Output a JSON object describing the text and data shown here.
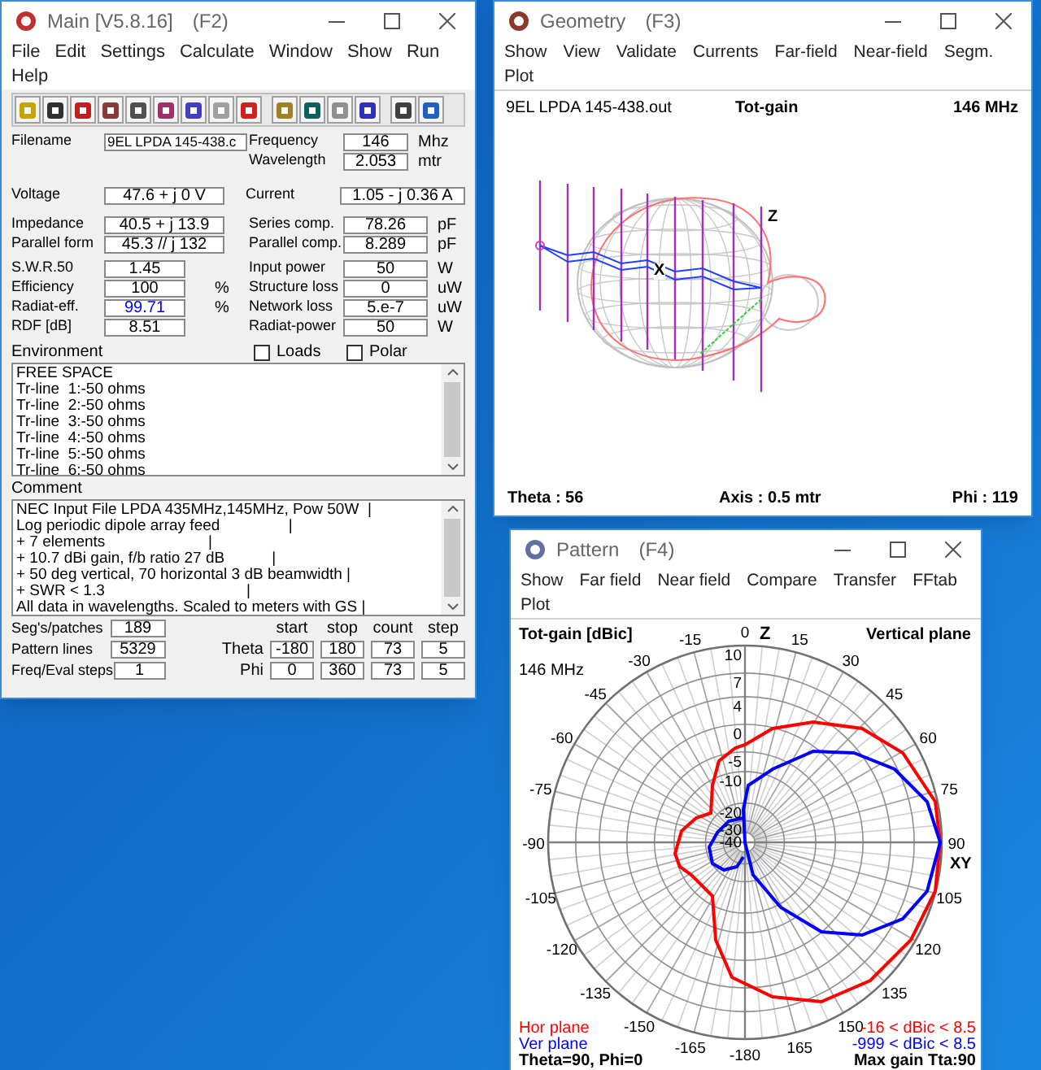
{
  "main": {
    "title": "Main [V5.8.16]",
    "hotkey": "(F2)",
    "menu": [
      "File",
      "Edit",
      "Settings",
      "Calculate",
      "Window",
      "Show",
      "Run",
      "Help"
    ],
    "field_groups": [
      [
        {
          "left": {
            "label": "Filename",
            "value": "9EL LPDA 145-438.c",
            "highlighted": false
          },
          "right": {
            "label": "Frequency",
            "value": "146",
            "unit": "Mhz",
            "highlighted": false
          }
        },
        {
          "right": {
            "label": "Wavelength",
            "value": "2.053",
            "unit": "mtr",
            "highlighted": false
          }
        }
      ],
      [
        {
          "left": {
            "label": "Voltage",
            "value": "47.6 + j 0 V",
            "highlighted": false
          },
          "right": {
            "label": "Current",
            "value": "1.05 - j 0.36 A",
            "highlighted": false
          }
        }
      ],
      [
        {
          "left": {
            "label": "Impedance",
            "value": "40.5 + j 13.9",
            "highlighted": false
          },
          "right": {
            "label": "Series comp.",
            "value": "78.26",
            "unit": "pF",
            "highlighted": false
          }
        },
        {
          "left": {
            "label": "Parallel form",
            "value": "45.3 // j 132",
            "highlighted": false
          },
          "right": {
            "label": "Parallel comp.",
            "value": "8.289",
            "unit": "pF",
            "highlighted": false
          }
        }
      ],
      [
        {
          "left": {
            "label": "S.W.R.50",
            "value": "1.45",
            "highlighted": false
          },
          "right": {
            "label": "Input power",
            "value": "50",
            "unit": "W",
            "highlighted": false
          }
        },
        {
          "left": {
            "label": "Efficiency",
            "value": "100",
            "unit": "%",
            "highlighted": false
          },
          "right": {
            "label": "Structure loss",
            "value": "0",
            "unit": "uW",
            "highlighted": false
          }
        },
        {
          "left": {
            "label": "Radiat-eff.",
            "value": "99.71",
            "unit": "%",
            "highlighted": true
          },
          "right": {
            "label": "Network loss",
            "value": "5.e-7",
            "unit": "uW",
            "highlighted": false
          }
        },
        {
          "left": {
            "label": "RDF [dB]",
            "value": "8.51",
            "highlighted": false
          },
          "right": {
            "label": "Radiat-power",
            "value": "50",
            "unit": "W",
            "highlighted": false
          }
        }
      ]
    ],
    "checkboxes": [
      {
        "label": "Loads",
        "checked": false
      },
      {
        "label": "Polar",
        "checked": false
      }
    ],
    "environment": {
      "label": "Environment",
      "lines": [
        "FREE SPACE",
        "Tr-line  1:-50 ohms",
        "Tr-line  2:-50 ohms",
        "Tr-line  3:-50 ohms",
        "Tr-line  4:-50 ohms",
        "Tr-line  5:-50 ohms",
        "Tr-line  6:-50 ohms"
      ]
    },
    "comment": {
      "label": "Comment",
      "lines": [
        "NEC Input File LPDA 435MHz,145MHz, Pow 50W  |",
        "Log periodic dipole array feed                |",
        "+ 7 elements                        |",
        "+ 10.7 dBi gain, f/b ratio 27 dB           |",
        "+ 50 deg vertical, 70 horizontal 3 dB beamwidth |",
        "+ SWR < 1.3                                 |",
        "All data in wavelengths. Scaled to meters with GS |"
      ]
    },
    "counts": [
      {
        "label": "Seg's/patches",
        "value": "189"
      },
      {
        "label": "Pattern lines",
        "value": "5329"
      },
      {
        "label": "Freq/Eval steps",
        "value": "1"
      }
    ],
    "range": {
      "columns": [
        "start",
        "stop",
        "count",
        "step"
      ],
      "rows": [
        {
          "label": "Theta",
          "values": [
            "-180",
            "180",
            "73",
            "5"
          ]
        },
        {
          "label": "Phi",
          "values": [
            "0",
            "360",
            "73",
            "5"
          ]
        }
      ]
    }
  },
  "geometry": {
    "title": "Geometry",
    "hotkey": "(F3)",
    "menu": [
      "Show",
      "View",
      "Validate",
      "Currents",
      "Far-field",
      "Near-field",
      "Segm.",
      "Plot"
    ],
    "header": {
      "file": "9EL LPDA 145-438.out",
      "quantity": "Tot-gain",
      "frequency": "146 MHz"
    },
    "axis_labels": [
      "Z",
      "X"
    ],
    "footer": {
      "theta": "Theta : 56",
      "axis": "Axis : 0.5 mtr",
      "phi": "Phi : 119"
    }
  },
  "pattern": {
    "title": "Pattern",
    "hotkey": "(F4)",
    "menu": [
      "Show",
      "Far field",
      "Near field",
      "Compare",
      "Transfer",
      "FFtab",
      "Plot"
    ],
    "quantity": "Tot-gain [dBic]",
    "plane": "Vertical plane",
    "frequency": "146 MHz",
    "angle_labels": [
      "0",
      "15",
      "30",
      "45",
      "60",
      "75",
      "90",
      "105",
      "120",
      "135",
      "150",
      "165",
      "-180",
      "-15",
      "-30",
      "-45",
      "-60",
      "-75",
      "-90",
      "-105",
      "-120",
      "-135",
      "-150",
      "-165"
    ],
    "ring_labels": [
      "10",
      "7",
      "4",
      "0",
      "-5",
      "-10",
      "-20",
      "-30",
      "-40"
    ],
    "axis_labels": {
      "top": "Z",
      "right": "XY"
    },
    "legend": [
      {
        "label": "Hor plane",
        "range": "-16 < dBic < 8.5",
        "color": "#ff0000"
      },
      {
        "label": "Ver plane",
        "range": "-999 < dBic < 8.5",
        "color": "#0000ff"
      }
    ],
    "footer_left": "Theta=90, Phi=0",
    "footer_right": "Max gain Tta:90"
  }
}
